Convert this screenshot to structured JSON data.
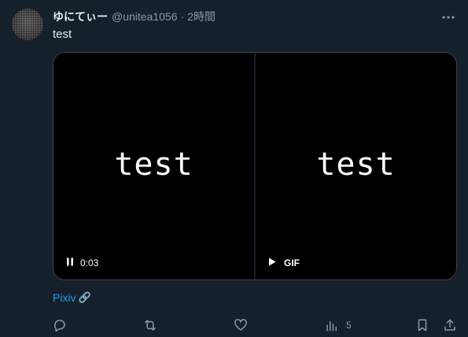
{
  "tweet": {
    "display_name": "ゆにてぃー",
    "handle": "@unitea1056",
    "separator": "·",
    "time": "2時間",
    "text": "test"
  },
  "media": {
    "left": {
      "text": "test",
      "control_icon": "pause-icon",
      "time": "0:03"
    },
    "right": {
      "text": "test",
      "control_icon": "play-icon",
      "badge": "GIF"
    }
  },
  "link": {
    "label": "Pixiv",
    "emoji": "🔗"
  },
  "actions": {
    "reply_icon": "reply-icon",
    "retweet_icon": "retweet-icon",
    "like_icon": "heart-icon",
    "views_icon": "views-icon",
    "views_count": "5",
    "bookmark_icon": "bookmark-icon",
    "share_icon": "share-icon"
  },
  "colors": {
    "background": "#15202b",
    "text": "#e7e9ea",
    "secondary": "#8b98a5",
    "link": "#1d9bf0"
  }
}
